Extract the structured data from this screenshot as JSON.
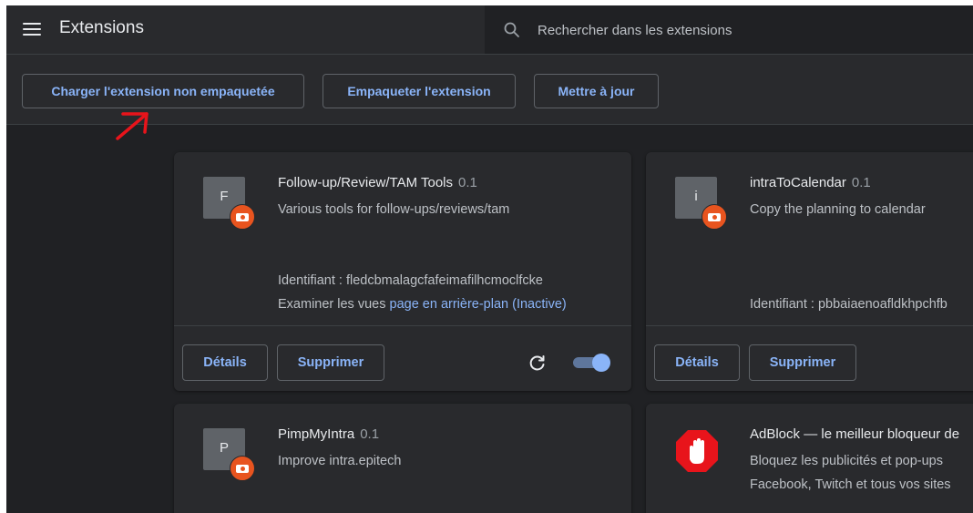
{
  "header": {
    "title": "Extensions",
    "search_placeholder": "Rechercher dans les extensions"
  },
  "toolbar": {
    "load_unpacked": "Charger l'extension non empaquetée",
    "pack": "Empaqueter l'extension",
    "update": "Mettre à jour"
  },
  "extensions": [
    {
      "icon_letter": "F",
      "name": "Follow-up/Review/TAM Tools",
      "version": "0.1",
      "description": "Various tools for follow-ups/reviews/tam",
      "id_text": "Identifiant : fledcbmalagcfafeimafilhcmoclfcke",
      "views_label": "Examiner les vues",
      "views_link": "page en arrière-plan (Inactive)",
      "details": "Détails",
      "remove": "Supprimer",
      "enabled": true
    },
    {
      "icon_letter": "i",
      "name": "intraToCalendar",
      "version": "0.1",
      "description": "Copy the planning to calendar",
      "id_text": "Identifiant : pbbaiaenoafldkhpchfb",
      "details": "Détails",
      "remove": "Supprimer"
    },
    {
      "icon_letter": "P",
      "name": "PimpMyIntra",
      "version": "0.1",
      "description": "Improve intra.epitech"
    },
    {
      "name": "AdBlock — le meilleur bloqueur de",
      "description_line1": "Bloquez les publicités et pop-ups",
      "description_line2": "Facebook, Twitch et tous vos sites"
    }
  ],
  "colors": {
    "background": "#202124",
    "surface": "#292a2d",
    "accent": "#8ab4f8",
    "badge": "#e8541f",
    "annotation_arrow": "#e8141b",
    "adblock_red": "#e8141b"
  },
  "icons": [
    "menu-icon",
    "search-icon",
    "reload-icon",
    "developer-mode-badge-icon",
    "adblock-hand-icon",
    "annotation-arrow"
  ]
}
